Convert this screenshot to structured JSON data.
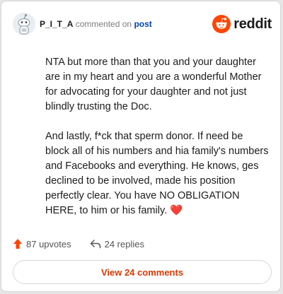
{
  "header": {
    "username": "P_I_T_A",
    "commented_text": "commented on",
    "post_link": "post",
    "brand_name": "reddit"
  },
  "comment": {
    "paragraph_1": "NTA but more than that you and your daughter are in my heart and you are a wonderful Mother for advocating for your daughter and not just blindly trusting the Doc.",
    "paragraph_2": "And lastly, f*ck that sperm donor. If need be block all of his numbers and hia family's numbers and Facebooks and everything. He knows, ges declined to be involved, made his position perfectly clear. You have NO OBLIGATION HERE, to him or his family.",
    "emoji": "❤️"
  },
  "actions": {
    "upvotes": "87 upvotes",
    "replies": "24 replies"
  },
  "view_button": "View 24 comments",
  "colors": {
    "reddit_orange": "#ff4500",
    "link_blue": "#0045ac",
    "button_text": "#d93a00"
  },
  "icons": {
    "avatar": "snoo-avatar-icon",
    "logo": "reddit-logo-icon",
    "upvote": "upvote-arrow-icon",
    "reply": "reply-arrow-icon"
  }
}
